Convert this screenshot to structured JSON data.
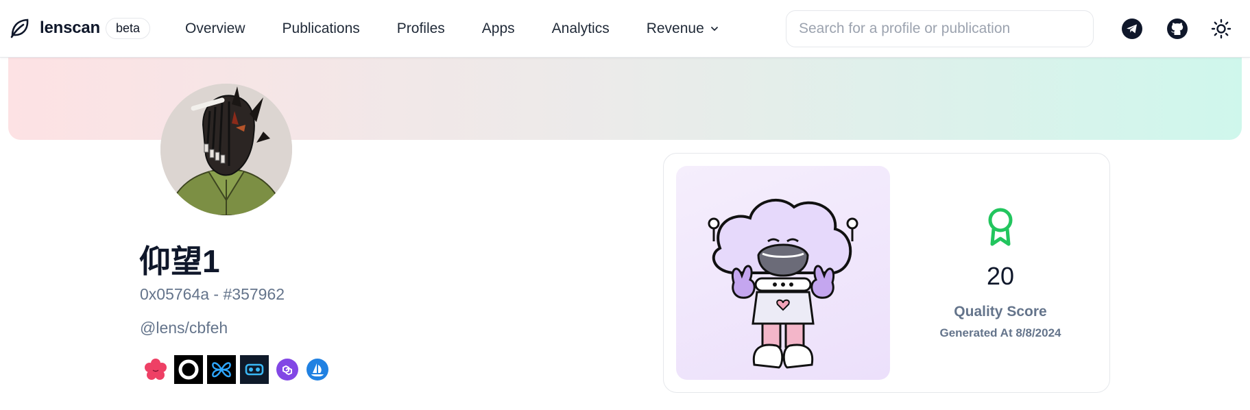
{
  "brand": {
    "name": "lenscan",
    "badge": "beta"
  },
  "nav": {
    "items": [
      {
        "label": "Overview"
      },
      {
        "label": "Publications"
      },
      {
        "label": "Profiles"
      },
      {
        "label": "Apps"
      },
      {
        "label": "Analytics"
      },
      {
        "label": "Revenue",
        "has_dropdown": true
      }
    ]
  },
  "search": {
    "placeholder": "Search for a profile or publication",
    "value": ""
  },
  "header_icons": [
    "telegram-icon",
    "github-icon",
    "sun-icon"
  ],
  "profile": {
    "name": "仰望1",
    "id_line": "0x05764a - #357962",
    "handle": "@lens/cbfeh",
    "apps": [
      "orb-flower",
      "orb-ring",
      "butterfly",
      "tape",
      "polygon",
      "opensea"
    ]
  },
  "score": {
    "value": "20",
    "label": "Quality Score",
    "generated": "Generated At 8/8/2024",
    "accent": "#22c55e"
  },
  "colors": {
    "banner_left": "#fde2e4",
    "banner_right": "#cff7ec",
    "muted_text": "#64748b"
  }
}
